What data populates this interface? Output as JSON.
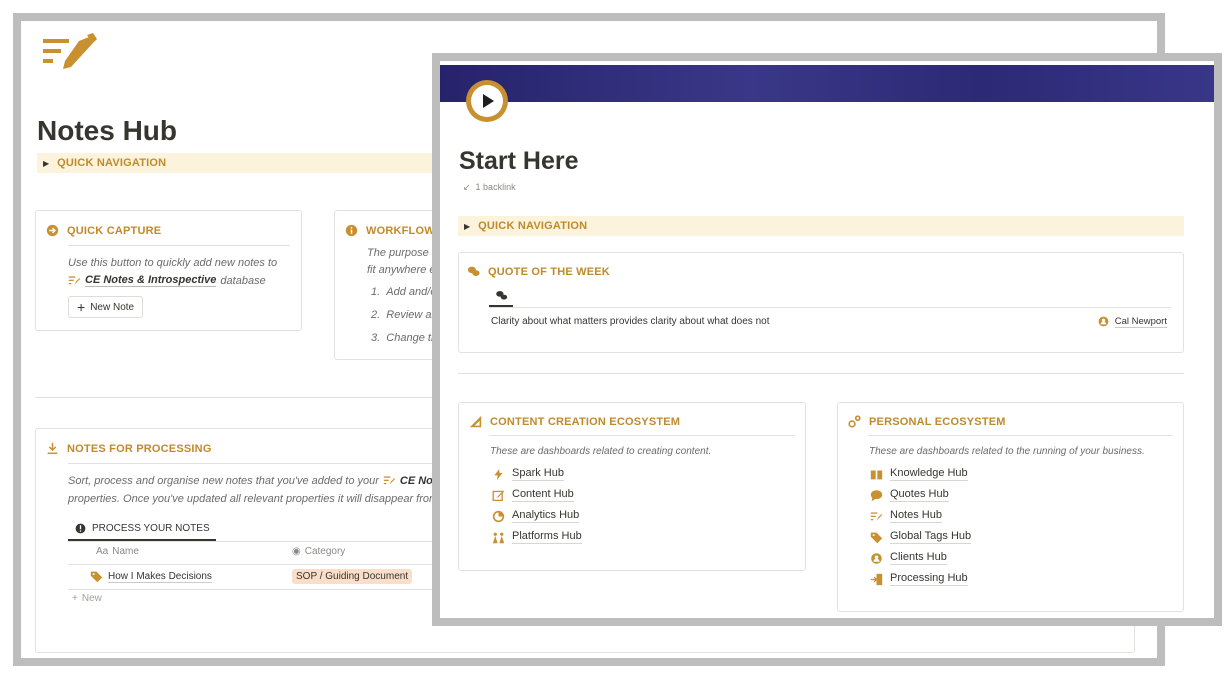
{
  "notes_hub": {
    "title": "Notes Hub",
    "quick_navigation": "QUICK NAVIGATION",
    "quick_capture": {
      "title": "QUICK CAPTURE",
      "desc_line1": "Use this button to quickly add new notes to",
      "db_name": "CE Notes & Introspective",
      "db_suffix": "database",
      "button": "New Note"
    },
    "workflow": {
      "title": "WORKFLOW",
      "desc_line1": "The purpose of",
      "desc_line2": "fit anywhere els",
      "steps": [
        "Add and/or",
        "Review and",
        "Change the"
      ]
    },
    "notes_for_processing": {
      "title": "NOTES FOR PROCESSING",
      "desc_line1_prefix": "Sort, process and organise new notes that you've added to your",
      "desc_line1_link": "CE Note",
      "desc_line2": "properties. Once you've updated all relevant properties it will disappear from",
      "view_tab": "PROCESS YOUR NOTES",
      "columns": [
        "Name",
        "Category"
      ],
      "name_col_prefix": "Aa",
      "rows": [
        {
          "name": "How I Makes Decisions",
          "category": "SOP / Guiding Document"
        }
      ],
      "new_row": "New"
    }
  },
  "start_here": {
    "title": "Start Here",
    "backlinks": "1 backlink",
    "quick_navigation": "QUICK NAVIGATION",
    "quote_of_week": {
      "title": "QUOTE OF THE WEEK",
      "quote": "Clarity about what matters provides clarity about what does not",
      "author": "Cal Newport"
    },
    "content_creation": {
      "title": "CONTENT CREATION ECOSYSTEM",
      "desc": "These are dashboards related to creating content.",
      "links": [
        "Spark Hub",
        "Content Hub",
        "Analytics Hub",
        "Platforms Hub"
      ]
    },
    "personal": {
      "title": "PERSONAL ECOSYSTEM",
      "desc": "These are dashboards related to the running of your business.",
      "links": [
        "Knowledge Hub",
        "Quotes Hub",
        "Notes Hub",
        "Global Tags Hub",
        "Clients Hub",
        "Processing Hub"
      ]
    }
  },
  "colors": {
    "accent": "#c08a2a",
    "nav_bg": "#fbf3dc",
    "cover": "#2c2a75",
    "tag_bg": "#fadec9"
  }
}
